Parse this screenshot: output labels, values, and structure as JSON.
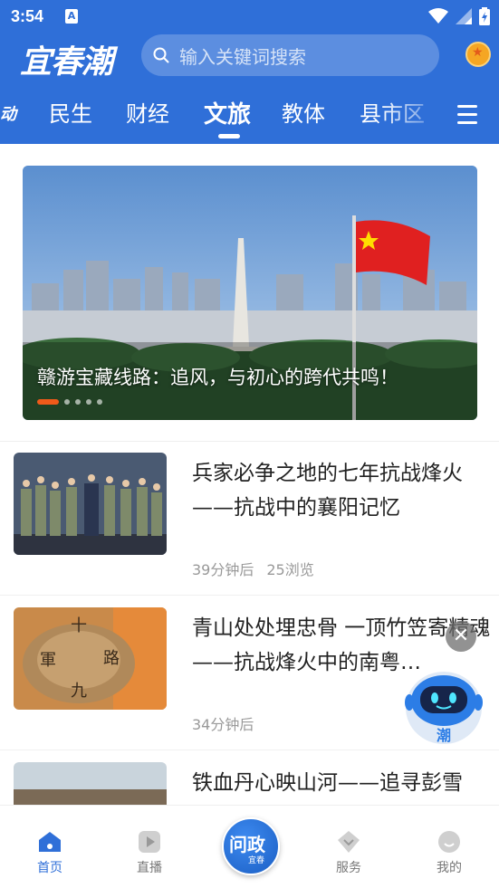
{
  "status_bar": {
    "time": "3:54",
    "notification_icon": "A"
  },
  "header": {
    "logo_text": "宜春潮",
    "search_placeholder": "输入关键词搜索",
    "coin_icon": "star-coin-icon"
  },
  "tabs": [
    {
      "label": "动",
      "partial": true
    },
    {
      "label": "民生"
    },
    {
      "label": "财经"
    },
    {
      "label": "文旅",
      "active": true
    },
    {
      "label": "教体"
    },
    {
      "label": "县市区"
    }
  ],
  "banner": {
    "title": "赣游宝藏线路：追风，与初心的跨代共鸣！",
    "slide_count": 5,
    "active_slide": 1
  },
  "news": [
    {
      "title": "兵家必争之地的七年抗战烽火——抗战中的襄阳记忆",
      "time": "39分钟后",
      "views": "25浏览"
    },
    {
      "title": "青山处处埋忠骨 一顶竹笠寄精魂——抗战烽火中的南粤…",
      "time": "34分钟后",
      "views": ""
    },
    {
      "title": "铁血丹心映山河——追寻彭雪",
      "time": "",
      "views": ""
    }
  ],
  "assistant": {
    "badge_text": "潮",
    "close_icon": "close-icon"
  },
  "bottom_nav": {
    "items": [
      {
        "label": "首页",
        "active": true
      },
      {
        "label": "直播"
      },
      {
        "label": "服务"
      },
      {
        "label": "我的"
      }
    ],
    "center": {
      "main": "问政",
      "sub": "宜春"
    }
  },
  "colors": {
    "brand_blue": "#2f6fd8",
    "accent_orange": "#f05a1a"
  }
}
